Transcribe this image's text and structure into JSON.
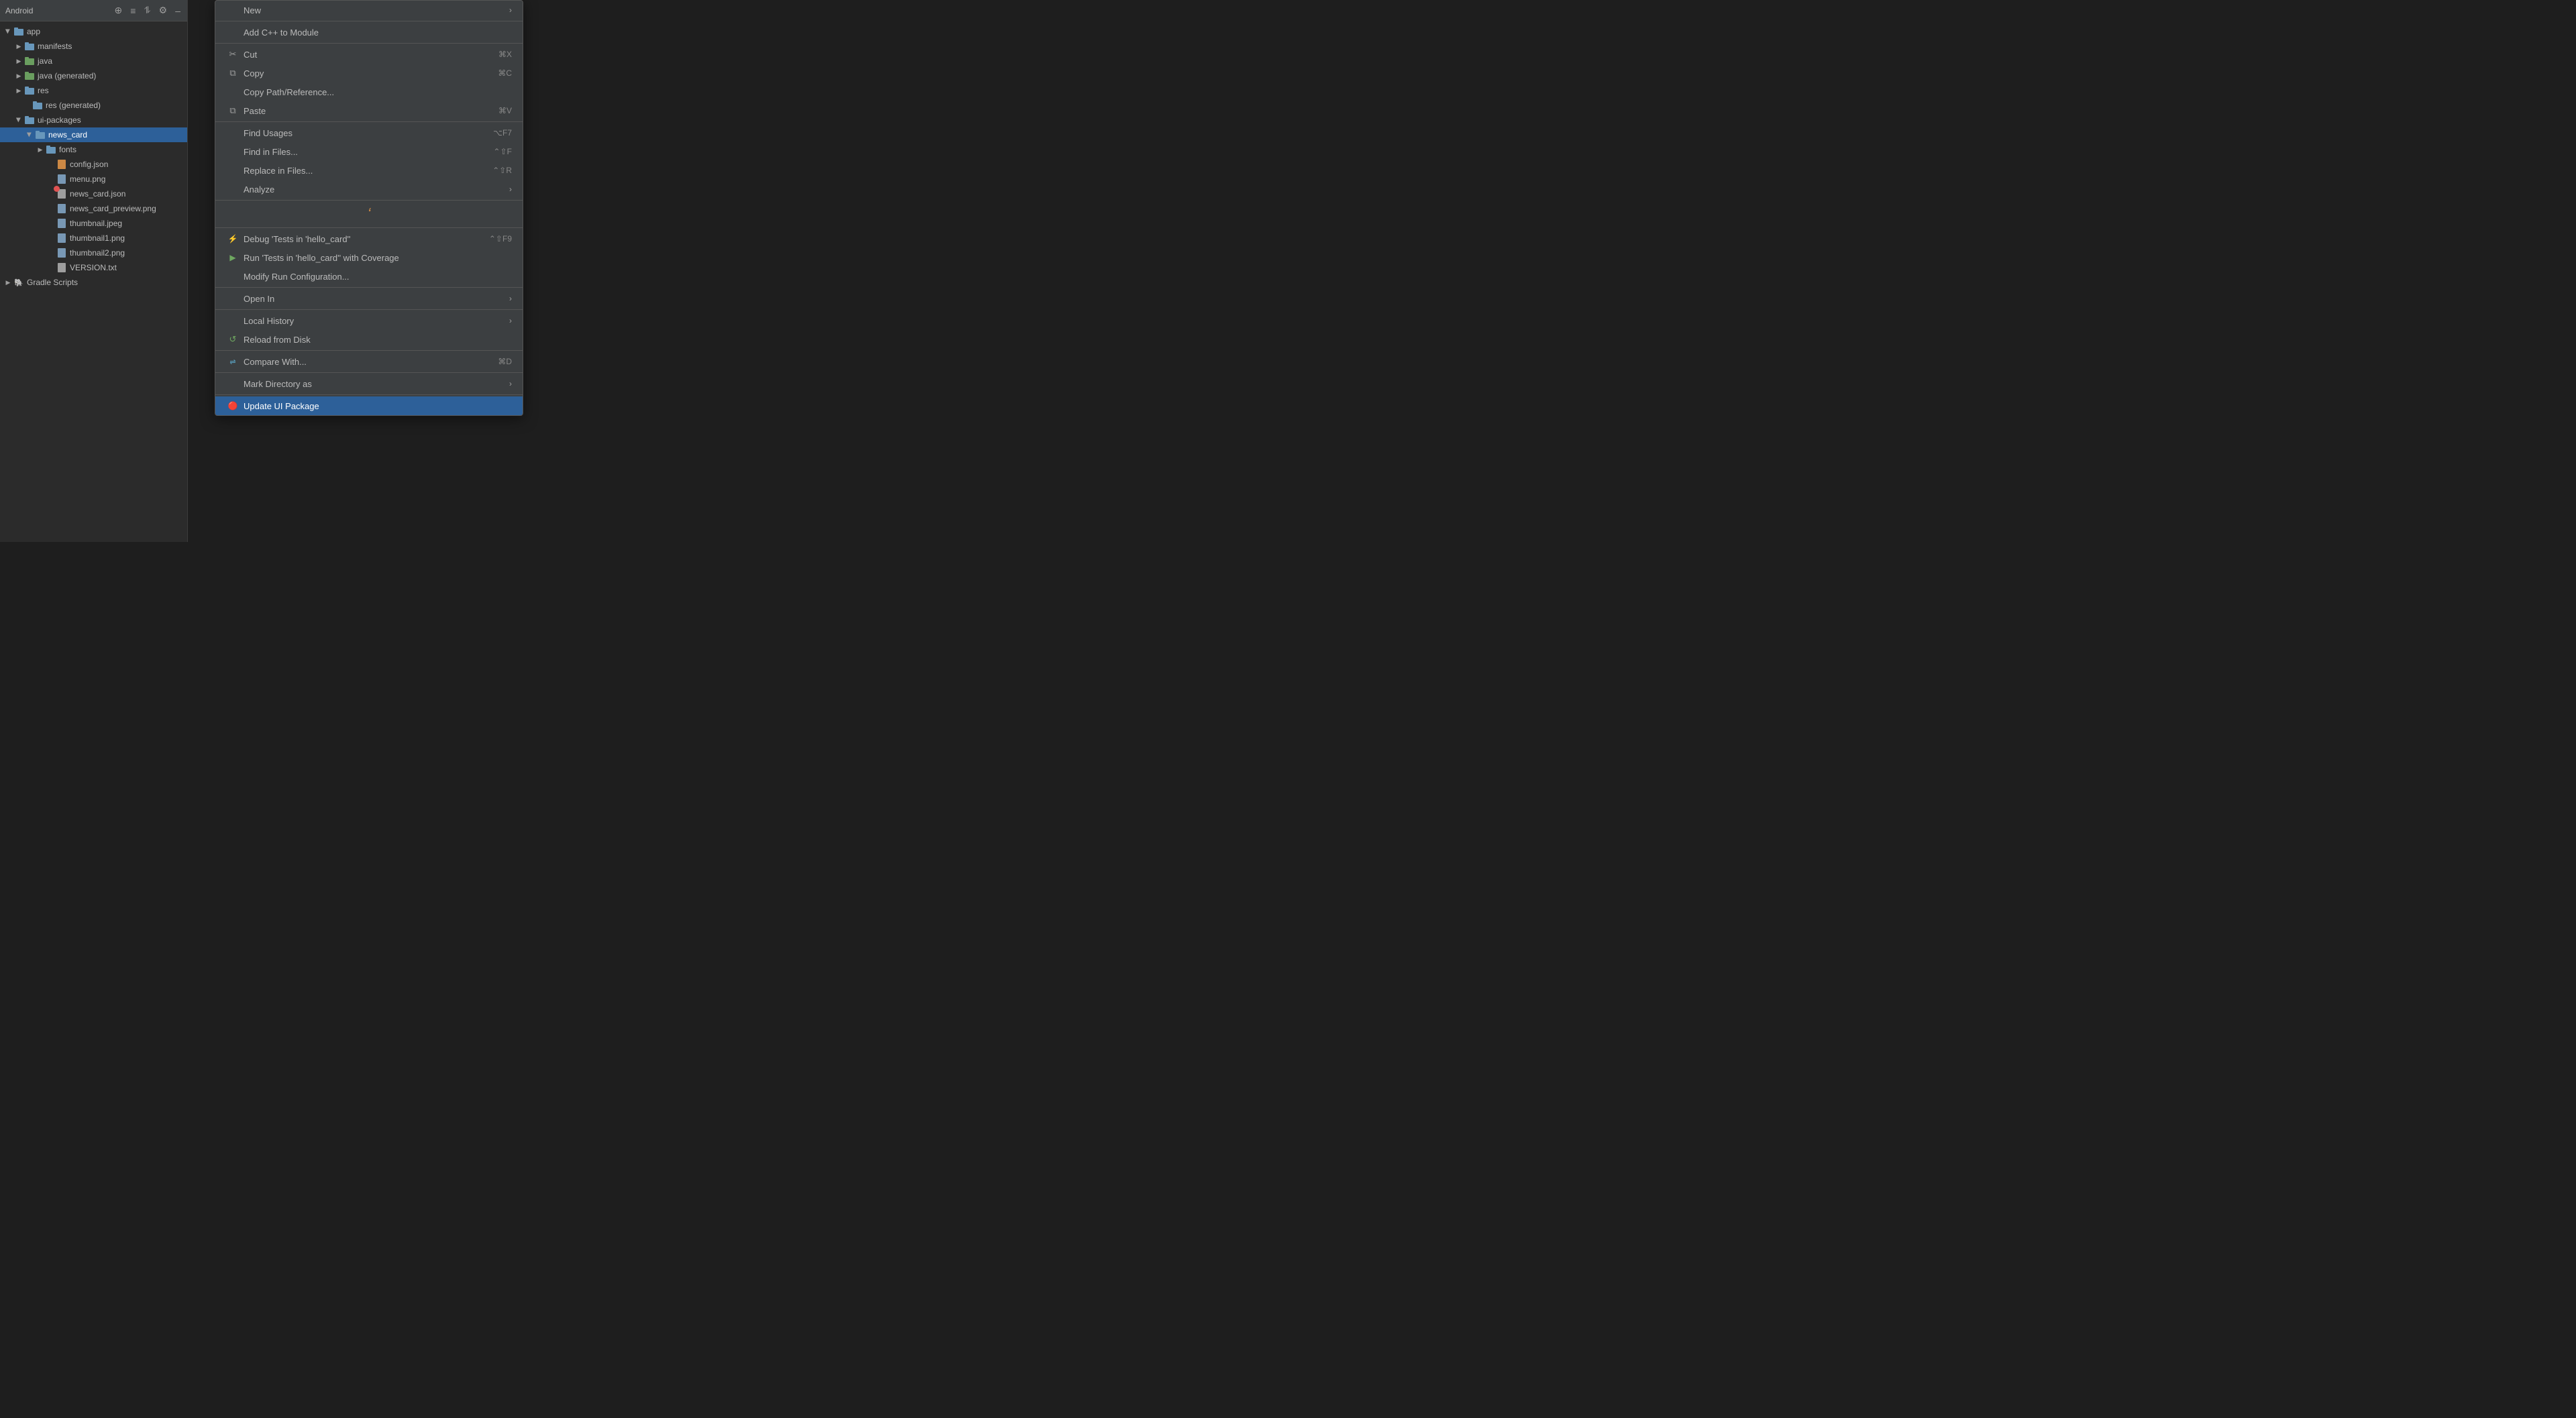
{
  "toolbar": {
    "title": "Android",
    "icons": [
      "⊕",
      "≡",
      "≡↕",
      "⚙",
      "–"
    ]
  },
  "file_tree": {
    "items": [
      {
        "id": "app",
        "label": "app",
        "type": "folder",
        "indent": 0,
        "expanded": true,
        "icon": "folder-blue"
      },
      {
        "id": "manifests",
        "label": "manifests",
        "type": "folder",
        "indent": 1,
        "expanded": false,
        "icon": "folder-blue"
      },
      {
        "id": "java",
        "label": "java",
        "type": "folder",
        "indent": 1,
        "expanded": false,
        "icon": "folder-green"
      },
      {
        "id": "java-gen",
        "label": "java",
        "type": "folder-gen",
        "indent": 1,
        "expanded": false,
        "icon": "folder-green",
        "suffix": "(generated)"
      },
      {
        "id": "res",
        "label": "res",
        "type": "folder",
        "indent": 1,
        "expanded": false,
        "icon": "folder-blue"
      },
      {
        "id": "res-gen",
        "label": "res",
        "type": "folder-gen",
        "indent": 1,
        "expanded": false,
        "icon": "folder-blue",
        "suffix": "(generated)"
      },
      {
        "id": "ui-packages",
        "label": "ui-packages",
        "type": "folder",
        "indent": 1,
        "expanded": true,
        "icon": "folder-blue"
      },
      {
        "id": "news_card",
        "label": "news_card",
        "type": "folder",
        "indent": 2,
        "expanded": true,
        "icon": "folder-blue",
        "selected": true
      },
      {
        "id": "fonts",
        "label": "fonts",
        "type": "folder",
        "indent": 3,
        "expanded": false,
        "icon": "folder-blue"
      },
      {
        "id": "config-json",
        "label": "config.json",
        "type": "file",
        "indent": 3,
        "icon": "json"
      },
      {
        "id": "menu-png",
        "label": "menu.png",
        "type": "file",
        "indent": 3,
        "icon": "png"
      },
      {
        "id": "news-card-json",
        "label": "news_card.json",
        "type": "file",
        "indent": 3,
        "icon": "red-dot"
      },
      {
        "id": "news-card-preview",
        "label": "news_card_preview.png",
        "type": "file",
        "indent": 3,
        "icon": "png"
      },
      {
        "id": "thumbnail-jpeg",
        "label": "thumbnail.jpeg",
        "type": "file",
        "indent": 3,
        "icon": "png"
      },
      {
        "id": "thumbnail1-png",
        "label": "thumbnail1.png",
        "type": "file",
        "indent": 3,
        "icon": "png"
      },
      {
        "id": "thumbnail2-png",
        "label": "thumbnail2.png",
        "type": "file",
        "indent": 3,
        "icon": "png"
      },
      {
        "id": "version-txt",
        "label": "VERSION.txt",
        "type": "file",
        "indent": 3,
        "icon": "txt"
      },
      {
        "id": "gradle-scripts",
        "label": "Gradle Scripts",
        "type": "folder",
        "indent": 0,
        "expanded": false,
        "icon": "gradle"
      }
    ]
  },
  "context_menu": {
    "items": [
      {
        "id": "new",
        "label": "New",
        "icon": "",
        "shortcut": "",
        "arrow": "›",
        "type": "item"
      },
      {
        "id": "divider1",
        "type": "divider"
      },
      {
        "id": "add-cpp",
        "label": "Add C++ to Module",
        "icon": "",
        "shortcut": "",
        "arrow": "",
        "type": "item"
      },
      {
        "id": "divider2",
        "type": "divider"
      },
      {
        "id": "cut",
        "label": "Cut",
        "icon": "✂",
        "shortcut": "⌘X",
        "arrow": "",
        "type": "item"
      },
      {
        "id": "copy",
        "label": "Copy",
        "icon": "⧉",
        "shortcut": "⌘C",
        "arrow": "",
        "type": "item"
      },
      {
        "id": "copy-path",
        "label": "Copy Path/Reference...",
        "icon": "",
        "shortcut": "",
        "arrow": "",
        "type": "item"
      },
      {
        "id": "paste",
        "label": "Paste",
        "icon": "⧉",
        "shortcut": "⌘V",
        "arrow": "",
        "type": "item"
      },
      {
        "id": "divider3",
        "type": "divider"
      },
      {
        "id": "find-usages",
        "label": "Find Usages",
        "icon": "",
        "shortcut": "⌥F7",
        "arrow": "",
        "type": "item"
      },
      {
        "id": "find-files",
        "label": "Find in Files...",
        "icon": "",
        "shortcut": "⌃⇧F",
        "arrow": "",
        "type": "item"
      },
      {
        "id": "replace-files",
        "label": "Replace in Files...",
        "icon": "",
        "shortcut": "⌃⇧R",
        "arrow": "",
        "type": "item"
      },
      {
        "id": "analyze",
        "label": "Analyze",
        "icon": "",
        "shortcut": "",
        "arrow": "›",
        "type": "item"
      },
      {
        "id": "divider4",
        "type": "divider"
      },
      {
        "id": "spinner",
        "type": "spinner"
      },
      {
        "id": "divider5",
        "type": "divider"
      },
      {
        "id": "debug",
        "label": "Debug 'Tests in 'hello_card''",
        "icon": "🐛",
        "shortcut": "⌃⇧F9",
        "arrow": "",
        "type": "item"
      },
      {
        "id": "run-coverage",
        "label": "Run 'Tests in 'hello_card'' with Coverage",
        "icon": "▶",
        "shortcut": "",
        "arrow": "",
        "type": "item"
      },
      {
        "id": "modify-run",
        "label": "Modify Run Configuration...",
        "icon": "",
        "shortcut": "",
        "arrow": "",
        "type": "item"
      },
      {
        "id": "divider6",
        "type": "divider"
      },
      {
        "id": "open-in",
        "label": "Open In",
        "icon": "",
        "shortcut": "",
        "arrow": "›",
        "type": "item"
      },
      {
        "id": "divider7",
        "type": "divider"
      },
      {
        "id": "local-history",
        "label": "Local History",
        "icon": "",
        "shortcut": "",
        "arrow": "›",
        "type": "item"
      },
      {
        "id": "reload-disk",
        "label": "Reload from Disk",
        "icon": "↺",
        "shortcut": "",
        "arrow": "",
        "type": "item"
      },
      {
        "id": "divider8",
        "type": "divider"
      },
      {
        "id": "compare-with",
        "label": "Compare With...",
        "icon": "⇌",
        "shortcut": "⌘D",
        "arrow": "",
        "type": "item"
      },
      {
        "id": "divider9",
        "type": "divider"
      },
      {
        "id": "mark-directory",
        "label": "Mark Directory as",
        "icon": "",
        "shortcut": "",
        "arrow": "›",
        "type": "item"
      },
      {
        "id": "divider10",
        "type": "divider"
      },
      {
        "id": "update-ui",
        "label": "Update UI Package",
        "icon": "🔴",
        "shortcut": "",
        "arrow": "",
        "type": "item",
        "highlighted": true
      }
    ]
  }
}
